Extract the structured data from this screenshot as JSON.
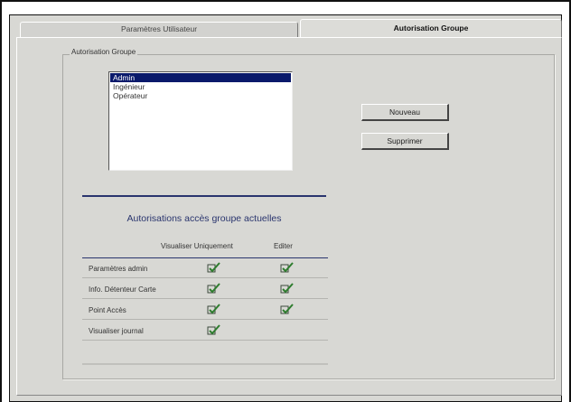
{
  "tabs": [
    {
      "label": "Paramètres Utilisateur",
      "active": false
    },
    {
      "label": "Autorisation Groupe",
      "active": true
    }
  ],
  "group_box": {
    "title": "Autorisation Groupe"
  },
  "groups": {
    "items": [
      "Admin",
      "Ingénieur",
      "Opérateur"
    ],
    "selected": "Admin"
  },
  "buttons": {
    "new_label": "Nouveau",
    "delete_label": "Supprimer"
  },
  "permissions": {
    "title": "Autorisations accès groupe actuelles",
    "col_view": "Visualiser Uniquement",
    "col_edit": "Editer",
    "rows": [
      {
        "label": "Paramètres admin",
        "view": true,
        "edit": true
      },
      {
        "label": "Info. Détenteur Carte",
        "view": true,
        "edit": true
      },
      {
        "label": "Point Accès",
        "view": true,
        "edit": true
      },
      {
        "label": "Visualiser journal",
        "view": true,
        "edit": false
      }
    ]
  },
  "colors": {
    "accent": "#2a356e",
    "selection": "#0a1a6b",
    "check": "#2e7d2e"
  }
}
